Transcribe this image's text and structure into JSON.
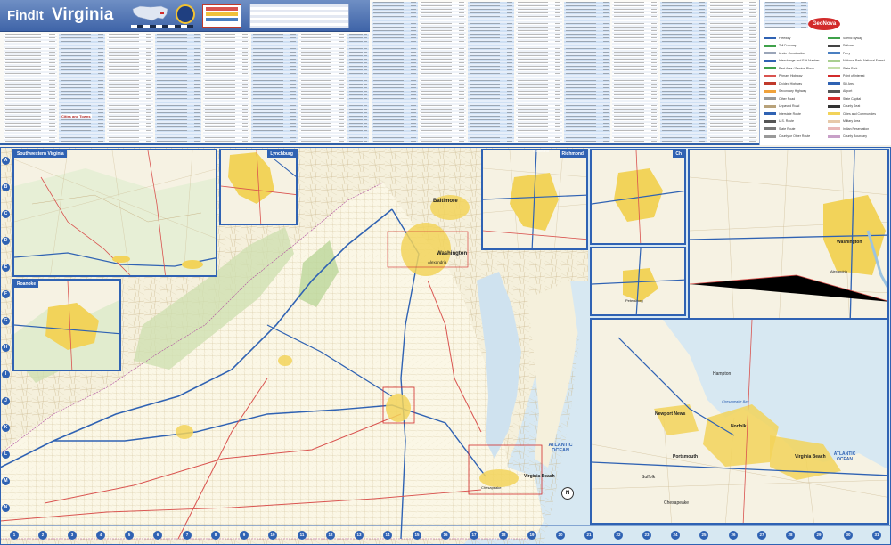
{
  "header": {
    "brand": "FindIt",
    "state": "Virginia"
  },
  "index": {
    "cities_label": "Cities and Towns"
  },
  "legend": {
    "logo": "GeoNova",
    "items": [
      {
        "label": "Freeway",
        "color": "#2f62b3"
      },
      {
        "label": "Toll Freeway",
        "color": "#3fa14a"
      },
      {
        "label": "Under Construction",
        "color": "#9aa5b8"
      },
      {
        "label": "Interchange and Exit Number",
        "color": "#2f62b3"
      },
      {
        "label": "Rest Area / Service Plaza",
        "color": "#3fa14a"
      },
      {
        "label": "Primary Highway",
        "color": "#d9534f"
      },
      {
        "label": "Divided Highway",
        "color": "#c0392b"
      },
      {
        "label": "Secondary Highway",
        "color": "#f0a23b"
      },
      {
        "label": "Other Road",
        "color": "#9a9a9a"
      },
      {
        "label": "Unpaved Road",
        "color": "#b8a27a"
      },
      {
        "label": "Interstate Route",
        "color": "#2f62b3"
      },
      {
        "label": "U.S. Route",
        "color": "#555555"
      },
      {
        "label": "State Route",
        "color": "#777777"
      },
      {
        "label": "County or Other Route",
        "color": "#999999"
      },
      {
        "label": "Scenic Byway",
        "color": "#3fa14a"
      },
      {
        "label": "Railroad",
        "color": "#444444"
      },
      {
        "label": "Ferry",
        "color": "#4a7fc1"
      },
      {
        "label": "National Park, National Forest",
        "color": "#a9cf8f"
      },
      {
        "label": "State Park",
        "color": "#c4dfa8"
      },
      {
        "label": "Point of Interest",
        "color": "#d22b2b"
      },
      {
        "label": "Ski Area",
        "color": "#2f62b3"
      },
      {
        "label": "Airport",
        "color": "#555555"
      },
      {
        "label": "State Capital",
        "color": "#d22b2b"
      },
      {
        "label": "County Seat",
        "color": "#333333"
      },
      {
        "label": "Cities and Communities",
        "color": "#f2d35a"
      },
      {
        "label": "Military Area",
        "color": "#e7c9a9"
      },
      {
        "label": "Indian Reservation",
        "color": "#e9b8b8"
      },
      {
        "label": "County Boundary",
        "color": "#c8a0c8"
      }
    ]
  },
  "insets": {
    "southwestern": "Southwestern Virginia",
    "lynchburg": "Lynchburg",
    "roanoke": "Roanoke",
    "richmond": "Richmond",
    "charlottesville": "Ch",
    "petersburg": "Petersburg",
    "washington": "Washington"
  },
  "labels": {
    "baltimore": "Baltimore",
    "washington": "Washington",
    "alexandria": "Alexandria",
    "virginia_beach": "Virginia Beach",
    "chesapeake": "Chesapeake",
    "norfolk": "Norfolk",
    "portsmouth": "Portsmouth",
    "hampton": "Hampton",
    "newport_news": "Newport News",
    "suffolk": "Suffolk",
    "atlantic_ocean": "ATLANTIC OCEAN",
    "chesapeake_bay": "Chesapeake Bay",
    "petersburg": "Petersburg",
    "richmond_city": "Richmond",
    "inset_wash_city": "Washington",
    "inset_alexandria": "Alexandria",
    "virginia_beach_inset": "Virginia Beach"
  },
  "compass": "N",
  "grid_numbers": [
    "1",
    "2",
    "3",
    "4",
    "5",
    "6",
    "7",
    "8",
    "9",
    "10",
    "11",
    "12",
    "13",
    "14",
    "15",
    "16",
    "17",
    "18",
    "19",
    "20",
    "21",
    "22",
    "23",
    "24",
    "25",
    "26",
    "27",
    "28",
    "29",
    "30",
    "31"
  ],
  "grid_letters": [
    "A",
    "B",
    "C",
    "D",
    "E",
    "F",
    "G",
    "H",
    "I",
    "J",
    "K",
    "L",
    "M",
    "N"
  ]
}
